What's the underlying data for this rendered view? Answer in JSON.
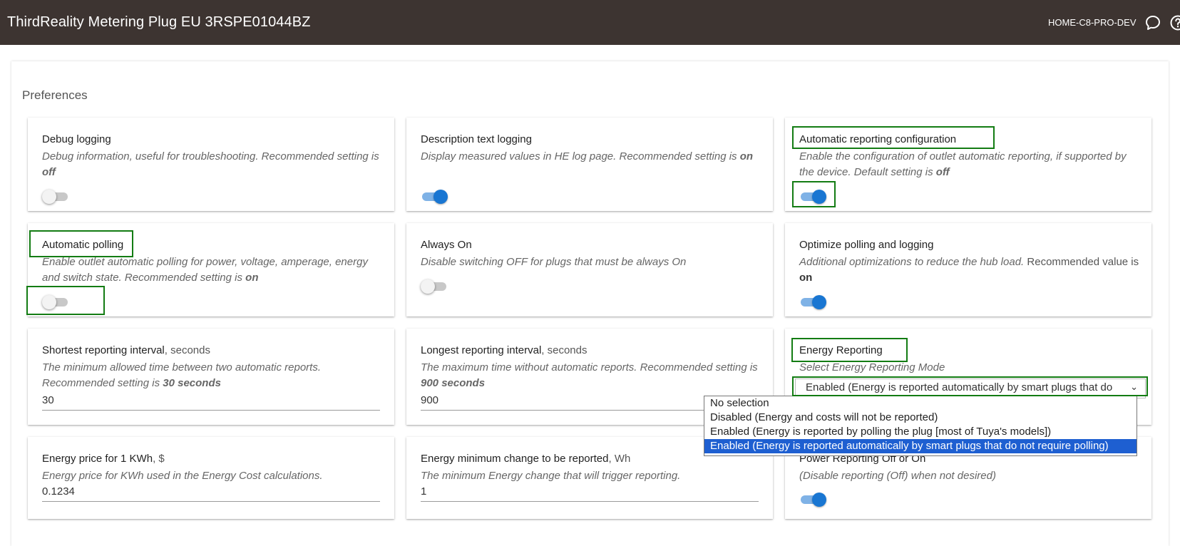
{
  "header": {
    "title": "ThirdReality Metering Plug EU 3RSPE01044BZ",
    "hub_name": "HOME-C8-PRO-DEV",
    "icons": [
      "chat-icon",
      "help-icon"
    ]
  },
  "section_title": "Preferences",
  "prefs": {
    "debug": {
      "label": "Debug logging",
      "desc": "Debug information, useful for troubleshooting. Recommended setting is",
      "desc_em": "off",
      "state": false
    },
    "desc_log": {
      "label": "Description text logging",
      "desc": "Display measured values in HE log page. Recommended setting is",
      "desc_em": "on",
      "state": true
    },
    "auto_report": {
      "label": "Automatic reporting configuration",
      "desc": "Enable the configuration of outlet automatic reporting, if supported by the device. Default setting is",
      "desc_em": "off",
      "state": true
    },
    "auto_poll": {
      "label": "Automatic polling",
      "desc": "Enable outlet automatic polling for power, voltage, amperage, energy and switch state. Recommended setting is",
      "desc_em": "on",
      "state": false
    },
    "always_on": {
      "label": "Always On",
      "desc": "Disable switching OFF for plugs that must be always On",
      "state": false
    },
    "optimize": {
      "label": "Optimize polling and logging",
      "desc": "Additional optimizations to reduce the hub load.",
      "desc_tail": "Recommended value is",
      "desc_em": "on",
      "state": true
    },
    "min_interval": {
      "label": "Shortest reporting interval",
      "unit": ", seconds",
      "desc": "The minimum allowed time between two automatic reports. Recommended setting is",
      "desc_em": "30 seconds",
      "value": "30"
    },
    "max_interval": {
      "label": "Longest reporting interval",
      "unit": ", seconds",
      "desc": "The maximum time without automatic reports. Recommended setting is",
      "desc_em": "900 seconds",
      "value": "900"
    },
    "energy_mode": {
      "label": "Energy Reporting",
      "desc": "Select Energy Reporting Mode",
      "selected": "Enabled (Energy is reported automatically by smart plugs that do not require polling)",
      "options": [
        "No selection",
        "Disabled (Energy and costs will not be reported)",
        "Enabled (Energy is reported by polling the plug [most of Tuya's models])",
        "Enabled (Energy is reported automatically by smart plugs that do not require polling)"
      ]
    },
    "energy_price": {
      "label": "Energy price for 1 KWh",
      "unit": ", $",
      "desc": "Energy price for KWh used in the Energy Cost calculations.",
      "value": "0.1234"
    },
    "energy_min_change": {
      "label": "Energy minimum change to be reported",
      "unit": ", Wh",
      "desc": "The minimum Energy change that will trigger reporting.",
      "value": "1"
    },
    "power_reporting": {
      "label": "Power Reporting Off or On",
      "desc": "(Disable reporting (Off) when not desired)",
      "state": true
    }
  },
  "colors": {
    "header_bg": "#3d3431",
    "toggle_on": "#1976d2",
    "highlight": "#137c13",
    "dropdown_selected": "#1e5fd1"
  }
}
